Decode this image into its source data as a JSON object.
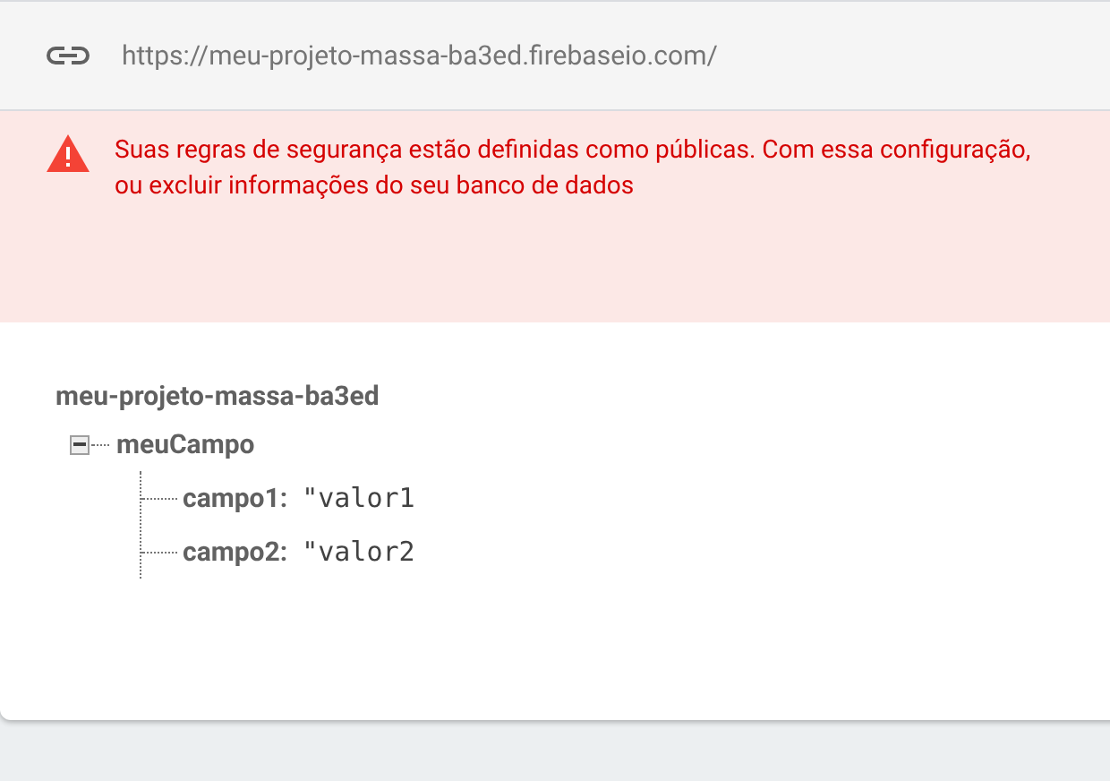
{
  "url": "https://meu-projeto-massa-ba3ed.firebaseio.com/",
  "warning": {
    "lines": [
      "Suas regras de segurança estão definidas como públicas. Com essa configuração,",
      "ou excluir informações do seu banco de dados"
    ]
  },
  "tree": {
    "label": "meu-projeto-massa-ba3ed",
    "children": [
      {
        "label": "meuCampo",
        "expanded": true,
        "children": [
          {
            "label": "campo1:",
            "value": "\"valor1"
          },
          {
            "label": "campo2:",
            "value": "\"valor2"
          }
        ]
      }
    ]
  }
}
